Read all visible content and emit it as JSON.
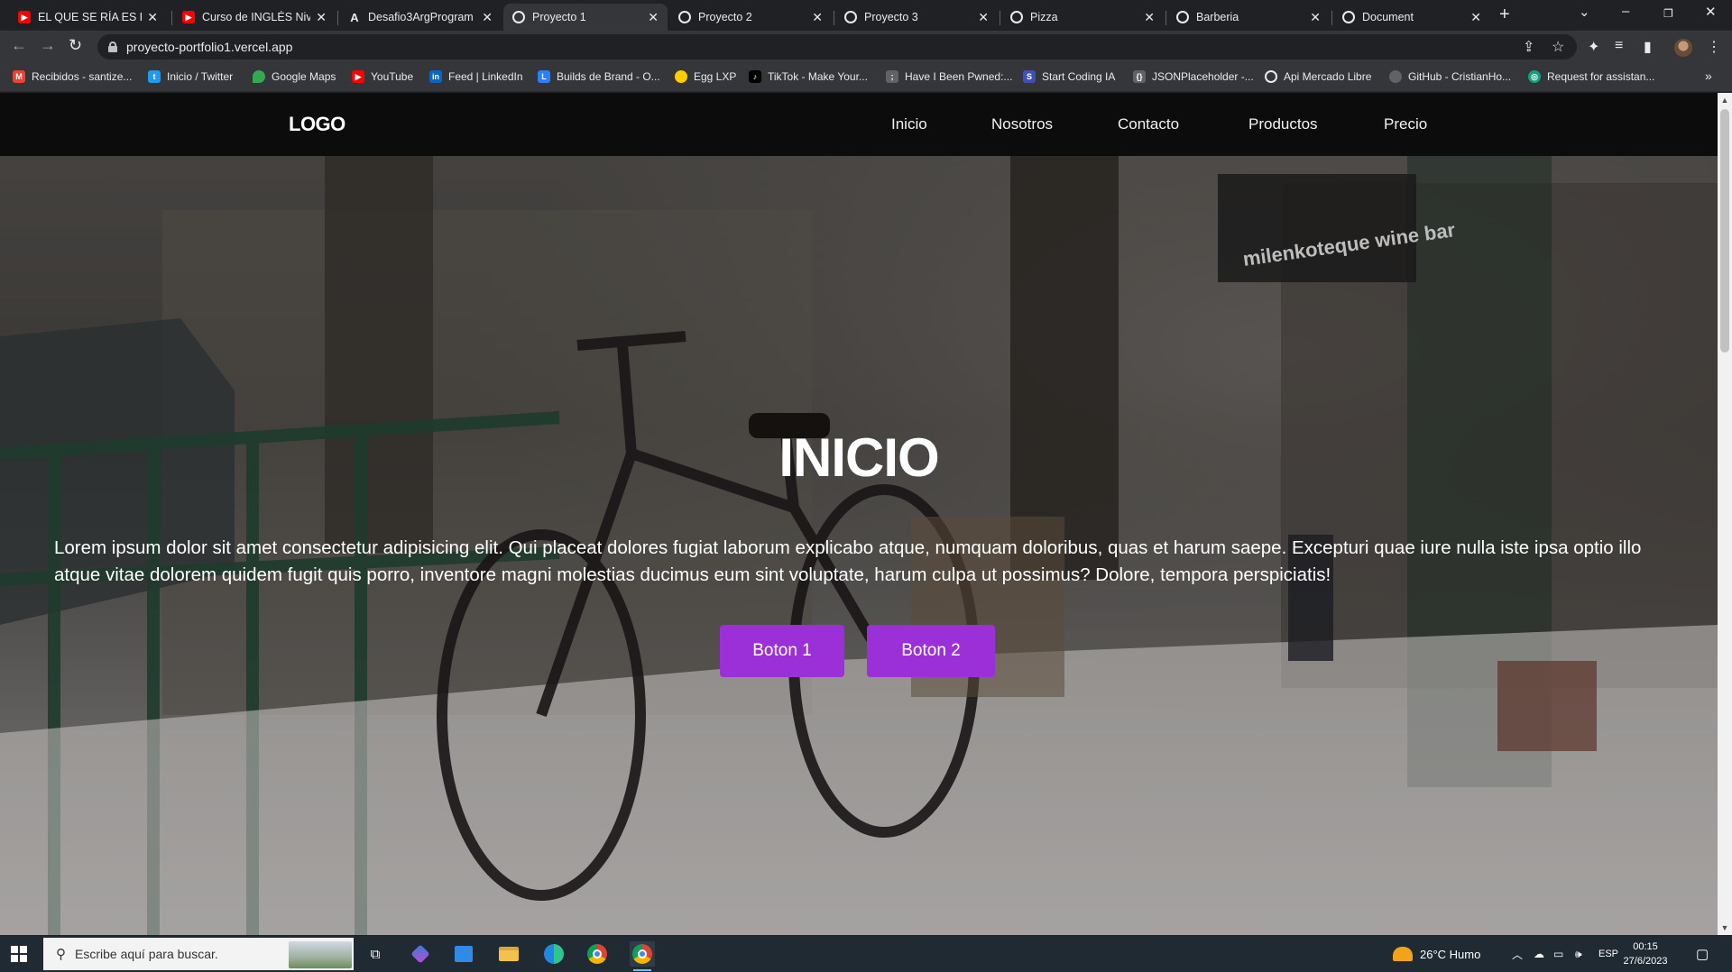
{
  "browser": {
    "tabs": [
      {
        "title": "EL QUE SE RÍA ES RAC",
        "icon": "youtube-icon",
        "active": false
      },
      {
        "title": "Curso de INGLÉS Nive",
        "icon": "youtube-icon",
        "active": false
      },
      {
        "title": "Desafio3ArgProgram",
        "icon": "a-logo-icon",
        "active": false
      },
      {
        "title": "Proyecto 1",
        "icon": "globe-icon",
        "active": true
      },
      {
        "title": "Proyecto 2",
        "icon": "globe-icon",
        "active": false
      },
      {
        "title": "Proyecto 3",
        "icon": "globe-icon",
        "active": false
      },
      {
        "title": "Pizza",
        "icon": "globe-icon",
        "active": false
      },
      {
        "title": "Barberia",
        "icon": "globe-icon",
        "active": false
      },
      {
        "title": "Document",
        "icon": "globe-icon",
        "active": false
      }
    ],
    "url": "proyecto-portfolio1.vercel.app",
    "bookmarks": [
      {
        "label": "Recibidos - santize...",
        "icon": "gmail-icon",
        "color": "#ea4335"
      },
      {
        "label": "Inicio / Twitter",
        "icon": "twitter-icon",
        "color": "#1d9bf0"
      },
      {
        "label": "Google Maps",
        "icon": "maps-icon",
        "color": "#34a853"
      },
      {
        "label": "YouTube",
        "icon": "youtube-icon",
        "color": "#ff0000"
      },
      {
        "label": "Feed | LinkedIn",
        "icon": "linkedin-icon",
        "color": "#0a66c2"
      },
      {
        "label": "Builds de Brand - O...",
        "icon": "builds-icon",
        "color": "#2d7ff9"
      },
      {
        "label": "Egg LXP",
        "icon": "egg-icon",
        "color": "#ffcc00"
      },
      {
        "label": "TikTok - Make Your...",
        "icon": "tiktok-icon",
        "color": "#000000"
      },
      {
        "label": "Have I Been Pwned:...",
        "icon": "pwned-icon",
        "color": "#5f6368"
      },
      {
        "label": "Start Coding IA",
        "icon": "coding-icon",
        "color": "#3f51b5"
      },
      {
        "label": "JSONPlaceholder -...",
        "icon": "json-icon",
        "color": "#5f6368"
      },
      {
        "label": "Api Mercado Libre",
        "icon": "globe-icon",
        "color": "#5f6368"
      },
      {
        "label": "GitHub - CristianHo...",
        "icon": "github-icon",
        "color": "#5f6368"
      },
      {
        "label": "Request for assistan...",
        "icon": "request-icon",
        "color": "#10a37f"
      }
    ]
  },
  "site": {
    "logo": "LOGO",
    "nav": [
      "Inicio",
      "Nosotros",
      "Contacto",
      "Productos",
      "Precio"
    ],
    "hero": {
      "title": "INICIO",
      "text": "Lorem ipsum dolor sit amet consectetur adipisicing elit. Qui placeat dolores fugiat laborum explicabo atque, numquam doloribus, quas et harum saepe. Excepturi quae iure nulla iste ipsa optio illo atque vitae dolorem quidem fugit quis porro, inventore magni molestias ducimus eum sint voluptate, harum culpa ut possimus? Dolore, tempora perspiciatis!",
      "button1": "Boton 1",
      "button2": "Boton 2",
      "sign_text": "milenkoteque wine bar",
      "accent_color": "#9b30d9"
    }
  },
  "taskbar": {
    "search_placeholder": "Escribe aquí para buscar.",
    "weather": "26°C  Humo",
    "language": "ESP",
    "time": "00:15",
    "date": "27/6/2023"
  }
}
